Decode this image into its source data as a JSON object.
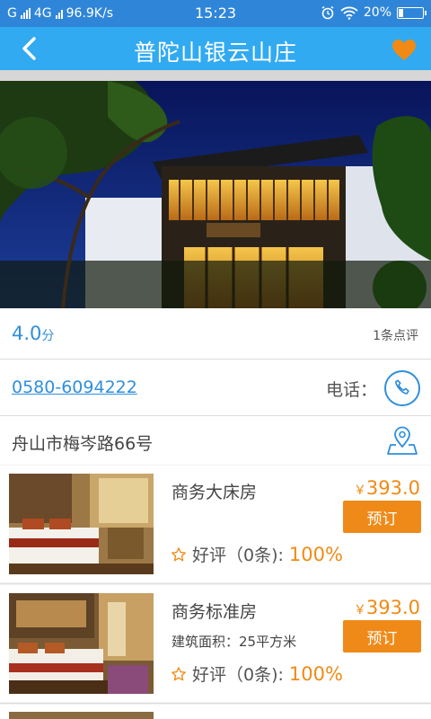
{
  "status_bar": {
    "carrier": "G",
    "network": "4G",
    "speed": "96.9K/s",
    "time": "15:23",
    "battery": "20%",
    "battery_level": 0.2
  },
  "header": {
    "back_icon": "back-arrow-icon",
    "title": "普陀山银云山庄",
    "favorite_icon": "heart-icon",
    "accent_color": "#31aaf1",
    "favorite_color": "#f08a14"
  },
  "hotel": {
    "score": "4.0",
    "score_unit": "分",
    "reviews": "1条点评",
    "phone": "0580-6094222",
    "phone_label": "电话：",
    "address": "舟山市梅岑路66号"
  },
  "rooms": [
    {
      "name": "商务大床房",
      "currency": "￥",
      "price": "393.0",
      "book_label": "预订",
      "area": "",
      "rating_label": "好评（0条):",
      "rating_pct": "100%"
    },
    {
      "name": "商务标准房",
      "currency": "￥",
      "price": "393.0",
      "book_label": "预订",
      "area": "建筑面积：25平方米",
      "rating_label": "好评（0条):",
      "rating_pct": "100%"
    }
  ],
  "colors": {
    "status_bar": "#2f86d9",
    "link_blue": "#2f8fdc",
    "price_orange": "#f08a14",
    "button_orange": "#ef8a19"
  }
}
